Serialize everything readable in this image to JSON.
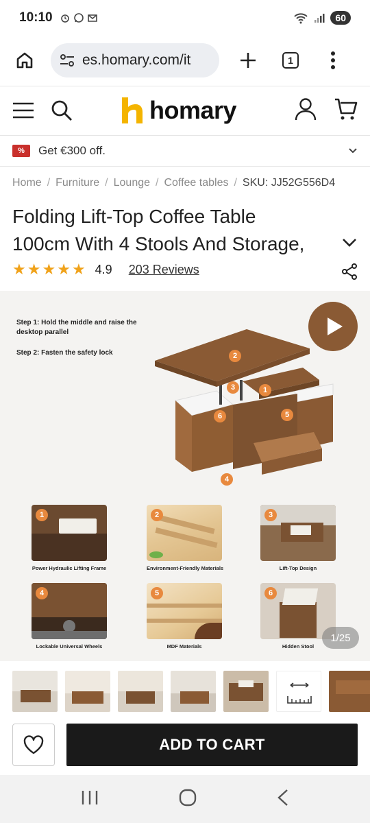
{
  "status_bar": {
    "time": "10:10",
    "battery": "60"
  },
  "browser": {
    "url": "es.homary.com/it",
    "tab_count": "1"
  },
  "site": {
    "logo_text": "homary"
  },
  "promo": {
    "text": "Get €300 off."
  },
  "breadcrumb": {
    "items": [
      "Home",
      "Furniture",
      "Lounge",
      "Coffee tables"
    ],
    "separator": "/",
    "sku": "SKU: JJ52G556D4"
  },
  "product": {
    "title_line1": "Folding Lift-Top Coffee Table",
    "title_line2": "100cm With 4 Stools And Storage,",
    "rating": "4.9",
    "stars": 5,
    "reviews": "203 Reviews"
  },
  "gallery": {
    "step1": "Step 1: Hold the middle and raise the desktop parallel",
    "step2": "Step 2:  Fasten the safety lock",
    "features": [
      {
        "num": "1",
        "caption": "Power Hydraulic Lifting Frame"
      },
      {
        "num": "2",
        "caption": "Environment-Friendly Materials"
      },
      {
        "num": "3",
        "caption": "Lift-Top Design"
      },
      {
        "num": "4",
        "caption": "Lockable Universal Wheels"
      },
      {
        "num": "5",
        "caption": "MDF Materials"
      },
      {
        "num": "6",
        "caption": "Hidden Stool"
      }
    ],
    "callouts": [
      "2",
      "3",
      "1",
      "6",
      "5",
      "4"
    ],
    "counter": "1/25"
  },
  "actions": {
    "add_to_cart": "ADD TO CART"
  },
  "colors": {
    "accent": "#f0a21a",
    "logo_yellow": "#f4b400",
    "wood": "#8a5a34",
    "badge": "#e8893e",
    "cart_bg": "#1a1a1a",
    "promo_tag": "#c9302c"
  }
}
